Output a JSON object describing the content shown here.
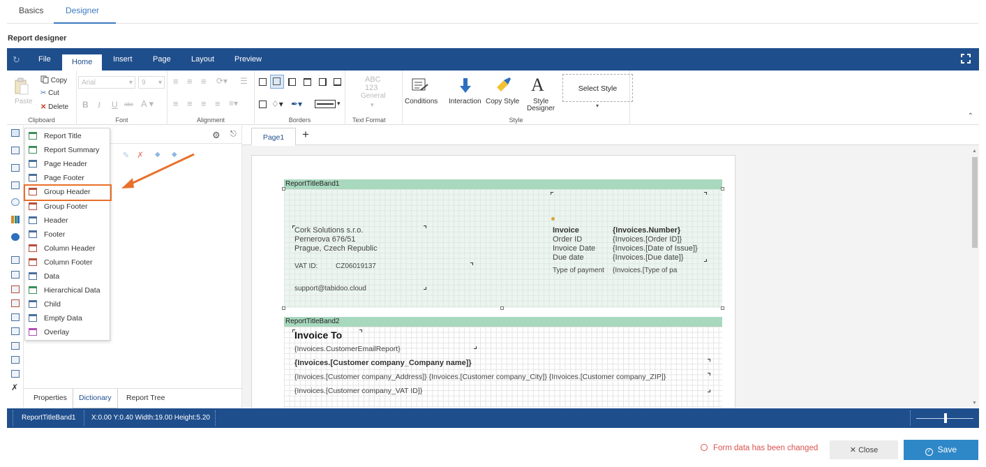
{
  "top_tabs": {
    "basics": "Basics",
    "designer": "Designer"
  },
  "section_title": "Report designer",
  "menu": {
    "file": "File",
    "home": "Home",
    "insert": "Insert",
    "page": "Page",
    "layout": "Layout",
    "preview": "Preview"
  },
  "ribbon": {
    "clipboard": {
      "label": "Clipboard",
      "paste": "Paste",
      "copy": "Copy",
      "cut": "Cut",
      "delete": "Delete"
    },
    "font": {
      "label": "Font",
      "family": "Arial",
      "size": "9"
    },
    "alignment": {
      "label": "Alignment"
    },
    "borders": {
      "label": "Borders"
    },
    "text_format": {
      "label": "Text Format",
      "abc": "ABC",
      "num": "123",
      "general": "General"
    },
    "style": {
      "label": "Style",
      "conditions": "Conditions",
      "interaction": "Interaction",
      "copy_style": "Copy Style",
      "style_designer_1": "Style",
      "style_designer_2": "Designer",
      "select_style": "Select Style"
    }
  },
  "insert_menu": {
    "items": [
      {
        "label": "Report Title",
        "color": "#3c8f5a"
      },
      {
        "label": "Report Summary",
        "color": "#3c8f5a"
      },
      {
        "label": "Page Header",
        "color": "#4a6f9c"
      },
      {
        "label": "Page Footer",
        "color": "#4a6f9c"
      },
      {
        "label": "Group Header",
        "color": "#b84b3a"
      },
      {
        "label": "Group Footer",
        "color": "#b84b3a"
      },
      {
        "label": "Header",
        "color": "#4a6f9c"
      },
      {
        "label": "Footer",
        "color": "#4a6f9c"
      },
      {
        "label": "Column Header",
        "color": "#b84b3a"
      },
      {
        "label": "Column Footer",
        "color": "#b84b3a"
      },
      {
        "label": "Data",
        "color": "#4a6f9c"
      },
      {
        "label": "Hierarchical Data",
        "color": "#3c8f5a"
      },
      {
        "label": "Child",
        "color": "#4a6f9c"
      },
      {
        "label": "Empty Data",
        "color": "#4a6f9c"
      },
      {
        "label": "Overlay",
        "color": "#b04fb0"
      }
    ]
  },
  "dict_tabs": {
    "properties": "Properties",
    "dictionary": "Dictionary",
    "report_tree": "Report Tree"
  },
  "page_tab": "Page1",
  "band1": {
    "name": "ReportTitleBand1",
    "company": "Cork Solutions s.r.o.",
    "street": "Pernerova 676/51",
    "city": "Prague, Czech Republic",
    "vat_label": "VAT ID:",
    "vat_value": "CZ06019137",
    "email": "support@tabidoo.cloud",
    "invoice_label": "Invoice",
    "order_label": "Order ID",
    "date_label": "Invoice Date",
    "due_label": "Due date",
    "payment_label": "Type of payment",
    "invoice_number": "{Invoices.Number}",
    "order_value": "{Invoices.[Order ID]}",
    "date_value": "{Invoices.[Date of Issue]}",
    "due_value": "{Invoices.[Due date]}",
    "payment_value": "{Invoices.[Type of pa"
  },
  "band2": {
    "name": "ReportTitleBand2",
    "invoice_to": "Invoice To",
    "email_field": "{Invoices.CustomerEmailReport}",
    "company_name": "{Invoices.[Customer company_Company name]}",
    "address_line": "{Invoices.[Customer company_Address]} {Invoices.[Customer company_City]} {Invoices.[Customer company_ZIP]}",
    "vat_field": "{Invoices.[Customer company_VAT ID]}"
  },
  "status": {
    "component": "ReportTitleBand1",
    "coords": "X:0.00 Y:0.40 Width:19.00 Height:5.20"
  },
  "footer": {
    "changed": "Form data has been changed",
    "close": "Close",
    "save": "Save"
  }
}
